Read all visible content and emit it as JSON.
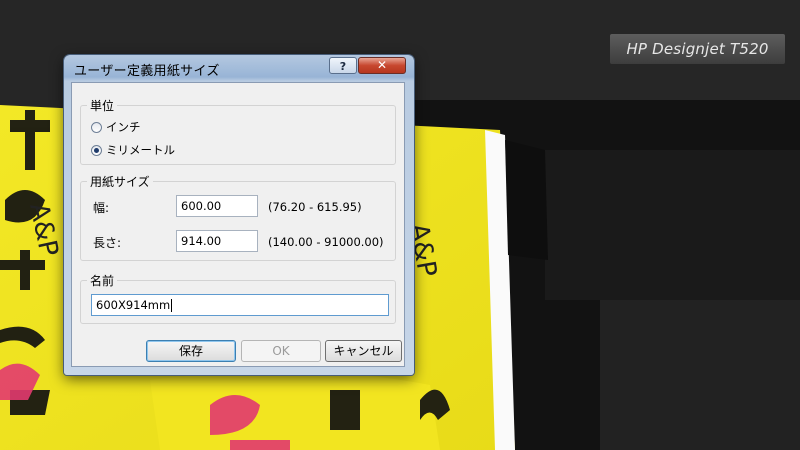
{
  "printer": {
    "model_label": "HP Designjet T520"
  },
  "paper_print": {
    "lines": [
      "A&P",
      "A&P"
    ]
  },
  "dialog": {
    "title": "ユーザー定義用紙サイズ",
    "help_label": "?",
    "close_label": "✕",
    "units": {
      "legend": "単位",
      "options": [
        {
          "label": "インチ",
          "selected": false
        },
        {
          "label": "ミリメートル",
          "selected": true
        }
      ]
    },
    "paper_size": {
      "legend": "用紙サイズ",
      "width": {
        "label": "幅:",
        "value": "600.00",
        "range": "(76.20 - 615.95)"
      },
      "length": {
        "label": "長さ:",
        "value": "914.00",
        "range": "(140.00 - 91000.00)"
      }
    },
    "name": {
      "legend": "名前",
      "value": "600X914mm"
    },
    "buttons": {
      "save": "保存",
      "ok": "OK",
      "cancel": "キャンセル"
    }
  }
}
